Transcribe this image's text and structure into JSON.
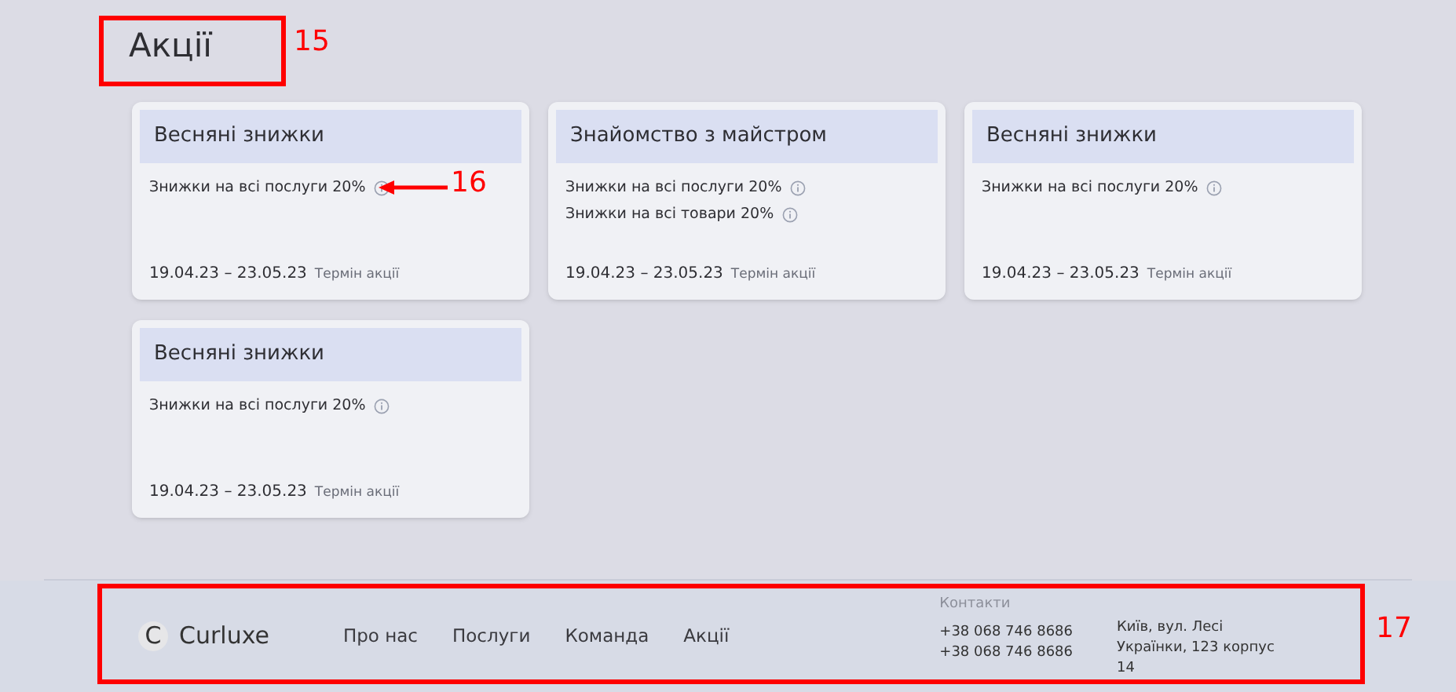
{
  "page_title": "Акції",
  "promotions": [
    {
      "title": "Весняні знижки",
      "offers": [
        "Знижки на всі послуги 20%"
      ],
      "period": "19.04.23 – 23.05.23",
      "period_label": "Термін акції"
    },
    {
      "title": "Знайомство з майстром",
      "offers": [
        "Знижки на всі послуги 20%",
        "Знижки на всі товари 20%"
      ],
      "period": "19.04.23 – 23.05.23",
      "period_label": "Термін акції"
    },
    {
      "title": "Весняні знижки",
      "offers": [
        "Знижки на всі послуги 20%"
      ],
      "period": "19.04.23 – 23.05.23",
      "period_label": "Термін акції"
    },
    {
      "title": "Весняні знижки",
      "offers": [
        "Знижки на всі послуги 20%"
      ],
      "period": "19.04.23 – 23.05.23",
      "period_label": "Термін акції"
    }
  ],
  "footer": {
    "logo_letter": "C",
    "brand": "Curluxe",
    "nav": [
      "Про нас",
      "Послуги",
      "Команда",
      "Акції"
    ],
    "contacts_label": "Контакти",
    "phones": [
      "+38 068 746 8686",
      "+38 068 746 8686"
    ],
    "address": "Київ, вул. Лесі Українки, 123 корпус 14"
  },
  "annotations": [
    {
      "label": "15"
    },
    {
      "label": "16"
    },
    {
      "label": "17"
    }
  ]
}
